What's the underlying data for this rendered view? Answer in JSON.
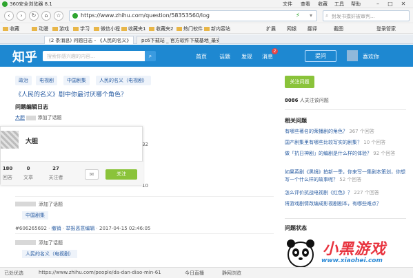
{
  "browser": {
    "app_title": "360安全浏览器 8.1",
    "menu": [
      "文件",
      "查看",
      "收藏",
      "工具",
      "帮助"
    ],
    "url": "https://www.zhihu.com/question/58353560/log",
    "search_placeholder": "封发书摸奸被审判..."
  },
  "bookmarks": [
    "收藏",
    "动漫",
    "游戏",
    "学习",
    "微信小程",
    "收藏夹1",
    "收藏夹2",
    "热门软件",
    "新内容站"
  ],
  "toolbar_right": [
    "扩展",
    "网银",
    "翻译",
    "截图",
    "登录管家"
  ],
  "tabs": [
    {
      "label": "(2 条消息) 问题日志 - 《人民的名义》",
      "active": true
    },
    {
      "label": "pc6下载站 _ 官方软件下载基地_最安全",
      "active": false
    }
  ],
  "zhihu_nav": {
    "brand": "知乎",
    "search_placeholder": "搜索你感兴趣的内容...",
    "links": [
      "首页",
      "话题",
      "发现",
      "消息"
    ],
    "notification_count": "2",
    "ask_button": "提问",
    "username": "喜欢你"
  },
  "question": {
    "tags": [
      "政治",
      "电视剧",
      "中国剧集",
      "人民的名义（电视剧）"
    ],
    "title": "《人民的名义》剧中你最讨厌哪个角色？",
    "log_heading": "问题编辑日志",
    "first_user": "大胆",
    "first_action": "添加了话题"
  },
  "popup": {
    "name": "大胆",
    "stats": [
      {
        "num": "180",
        "label": "回答"
      },
      {
        "num": "0",
        "label": "文章"
      },
      {
        "num": "27",
        "label": "关注者"
      }
    ],
    "follow_button": "关注"
  },
  "log_fragments": [
    "32",
    "10"
  ],
  "log_entries": [
    {
      "action": "添加了话题",
      "topic": "中国剧集",
      "revision": "#606265692",
      "revert": "撤销",
      "report": "举报恶意编辑",
      "time": "2017-04-15 02:46:05"
    },
    {
      "action": "添加了话题",
      "topic": "人民的名义（电视剧）",
      "revision": "",
      "revert": "",
      "report": "",
      "time": ""
    }
  ],
  "sidebar": {
    "follow_button": "关注问题",
    "follow_count": "8086",
    "follow_suffix": "人关注该问题",
    "related_title": "相关问题",
    "related": [
      {
        "text": "有哪些著名的荣播剧的角色？",
        "count": "367 个回答"
      },
      {
        "text": "国产剧集里有哪些比较写实的剧集？",
        "count": "10 个回答"
      },
      {
        "text": "做「抗日神剧」的编剧是什么样的体验？",
        "count": "92 个回答"
      },
      {
        "text": "如果英剧《黑镜》拍新一季，你来写一集剧本策划，你想写一个什么样的故事呢？",
        "count": "52 个回答"
      },
      {
        "text": "怎么评价抗战电视剧《红色》？",
        "count": "227 个回答"
      },
      {
        "text": "将游戏剧情改编成影视剧剧本，有哪些难点？",
        "count": ""
      }
    ],
    "status_title": "问题状态"
  },
  "statusbar": {
    "left": "已处优选",
    "url": "https://www.zhihu.com/people/da-dan-diao-min-61",
    "right": [
      "今日直播",
      "静网浏览"
    ]
  },
  "watermark": {
    "text": "小黑游戏",
    "url": "www.xiaohei.com"
  }
}
